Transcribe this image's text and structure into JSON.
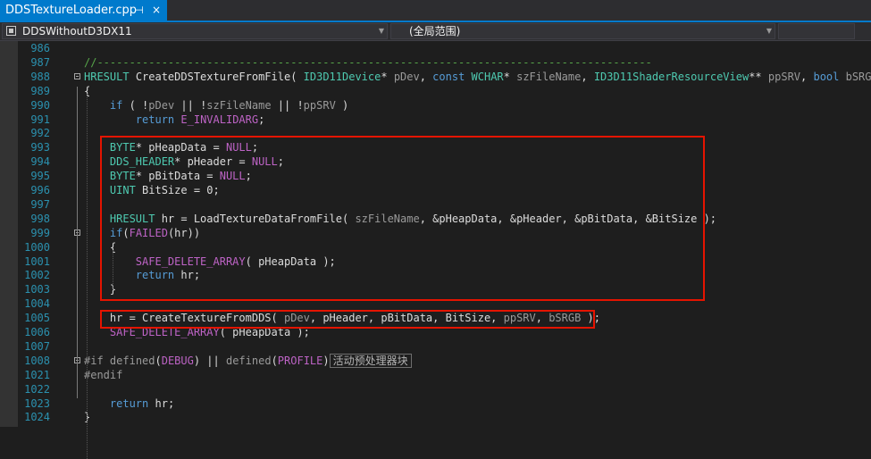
{
  "tab": {
    "title": "DDSTextureLoader.cpp",
    "pin": "⊣",
    "close": "×"
  },
  "nav": {
    "project": "DDSWithoutD3DX11",
    "scope": "(全局范围)"
  },
  "lines": [
    {
      "n": "986",
      "html": ""
    },
    {
      "n": "987",
      "html": "<span class='cm'>//--------------------------------------------------------------------------------------</span>"
    },
    {
      "n": "988",
      "fold": "minus",
      "html": "<span class='ty'>HRESULT</span> <span class='fn'>CreateDDSTextureFromFile</span>( <span class='ty'>ID3D11Device</span>* <span class='pm'>pDev</span>, <span class='kw'>const</span> <span class='ty'>WCHAR</span>* <span class='pm'>szFileName</span>, <span class='ty'>ID3D11ShaderResourceView</span>** <span class='pm'>ppSRV</span>, <span class='kw'>bool</span> <span class='pm'>bSRGB</span> )"
    },
    {
      "n": "989",
      "html": "{"
    },
    {
      "n": "990",
      "html": "    <span class='kw'>if</span> ( !<span class='pm'>pDev</span> || !<span class='pm'>szFileName</span> || !<span class='pm'>ppSRV</span> )"
    },
    {
      "n": "991",
      "html": "        <span class='kw'>return</span> <span class='mc'>E_INVALIDARG</span>;"
    },
    {
      "n": "992",
      "html": ""
    },
    {
      "n": "993",
      "html": "    <span class='ty'>BYTE</span>* pHeapData = <span class='mc'>NULL</span>;"
    },
    {
      "n": "994",
      "html": "    <span class='ty'>DDS_HEADER</span>* pHeader = <span class='mc'>NULL</span>;"
    },
    {
      "n": "995",
      "html": "    <span class='ty'>BYTE</span>* pBitData = <span class='mc'>NULL</span>;"
    },
    {
      "n": "996",
      "html": "    <span class='ty'>UINT</span> BitSize = 0;"
    },
    {
      "n": "997",
      "html": ""
    },
    {
      "n": "998",
      "html": "    <span class='ty'>HRESULT</span> hr = LoadTextureDataFromFile( <span class='pm'>szFileName</span>, &amp;pHeapData, &amp;pHeader, &amp;pBitData, &amp;BitSize );"
    },
    {
      "n": "999",
      "fold": "minus",
      "html": "    <span class='kw'>if</span>(<span class='mc'>FAILED</span>(hr))"
    },
    {
      "n": "1000",
      "html": "    {"
    },
    {
      "n": "1001",
      "html": "        <span class='mc'>SAFE_DELETE_ARRAY</span>( pHeapData );"
    },
    {
      "n": "1002",
      "html": "        <span class='kw'>return</span> hr;"
    },
    {
      "n": "1003",
      "html": "    }"
    },
    {
      "n": "1004",
      "html": ""
    },
    {
      "n": "1005",
      "html": "    hr = CreateTextureFromDDS( <span class='pm'>pDev</span>, pHeader, pBitData, BitSize, <span class='pm'>ppSRV</span>, <span class='pm'>bSRGB</span> );"
    },
    {
      "n": "1006",
      "html": "    <span class='mc'>SAFE_DELETE_ARRAY</span>( pHeapData );"
    },
    {
      "n": "1007",
      "html": ""
    },
    {
      "n": "1008",
      "fold": "plus",
      "html": "<span class='pm'>#if</span> <span class='pm'>defined</span>(<span class='mc'>DEBUG</span>) || <span class='pm'>defined</span>(<span class='mc'>PROFILE</span>)<span class='collapsed'>活动预处理器块</span>"
    },
    {
      "n": "1021",
      "html": "<span class='pm'>#endif</span>"
    },
    {
      "n": "1022",
      "html": ""
    },
    {
      "n": "1023",
      "html": "    <span class='kw'>return</span> hr;"
    },
    {
      "n": "1024",
      "html": "}"
    }
  ]
}
